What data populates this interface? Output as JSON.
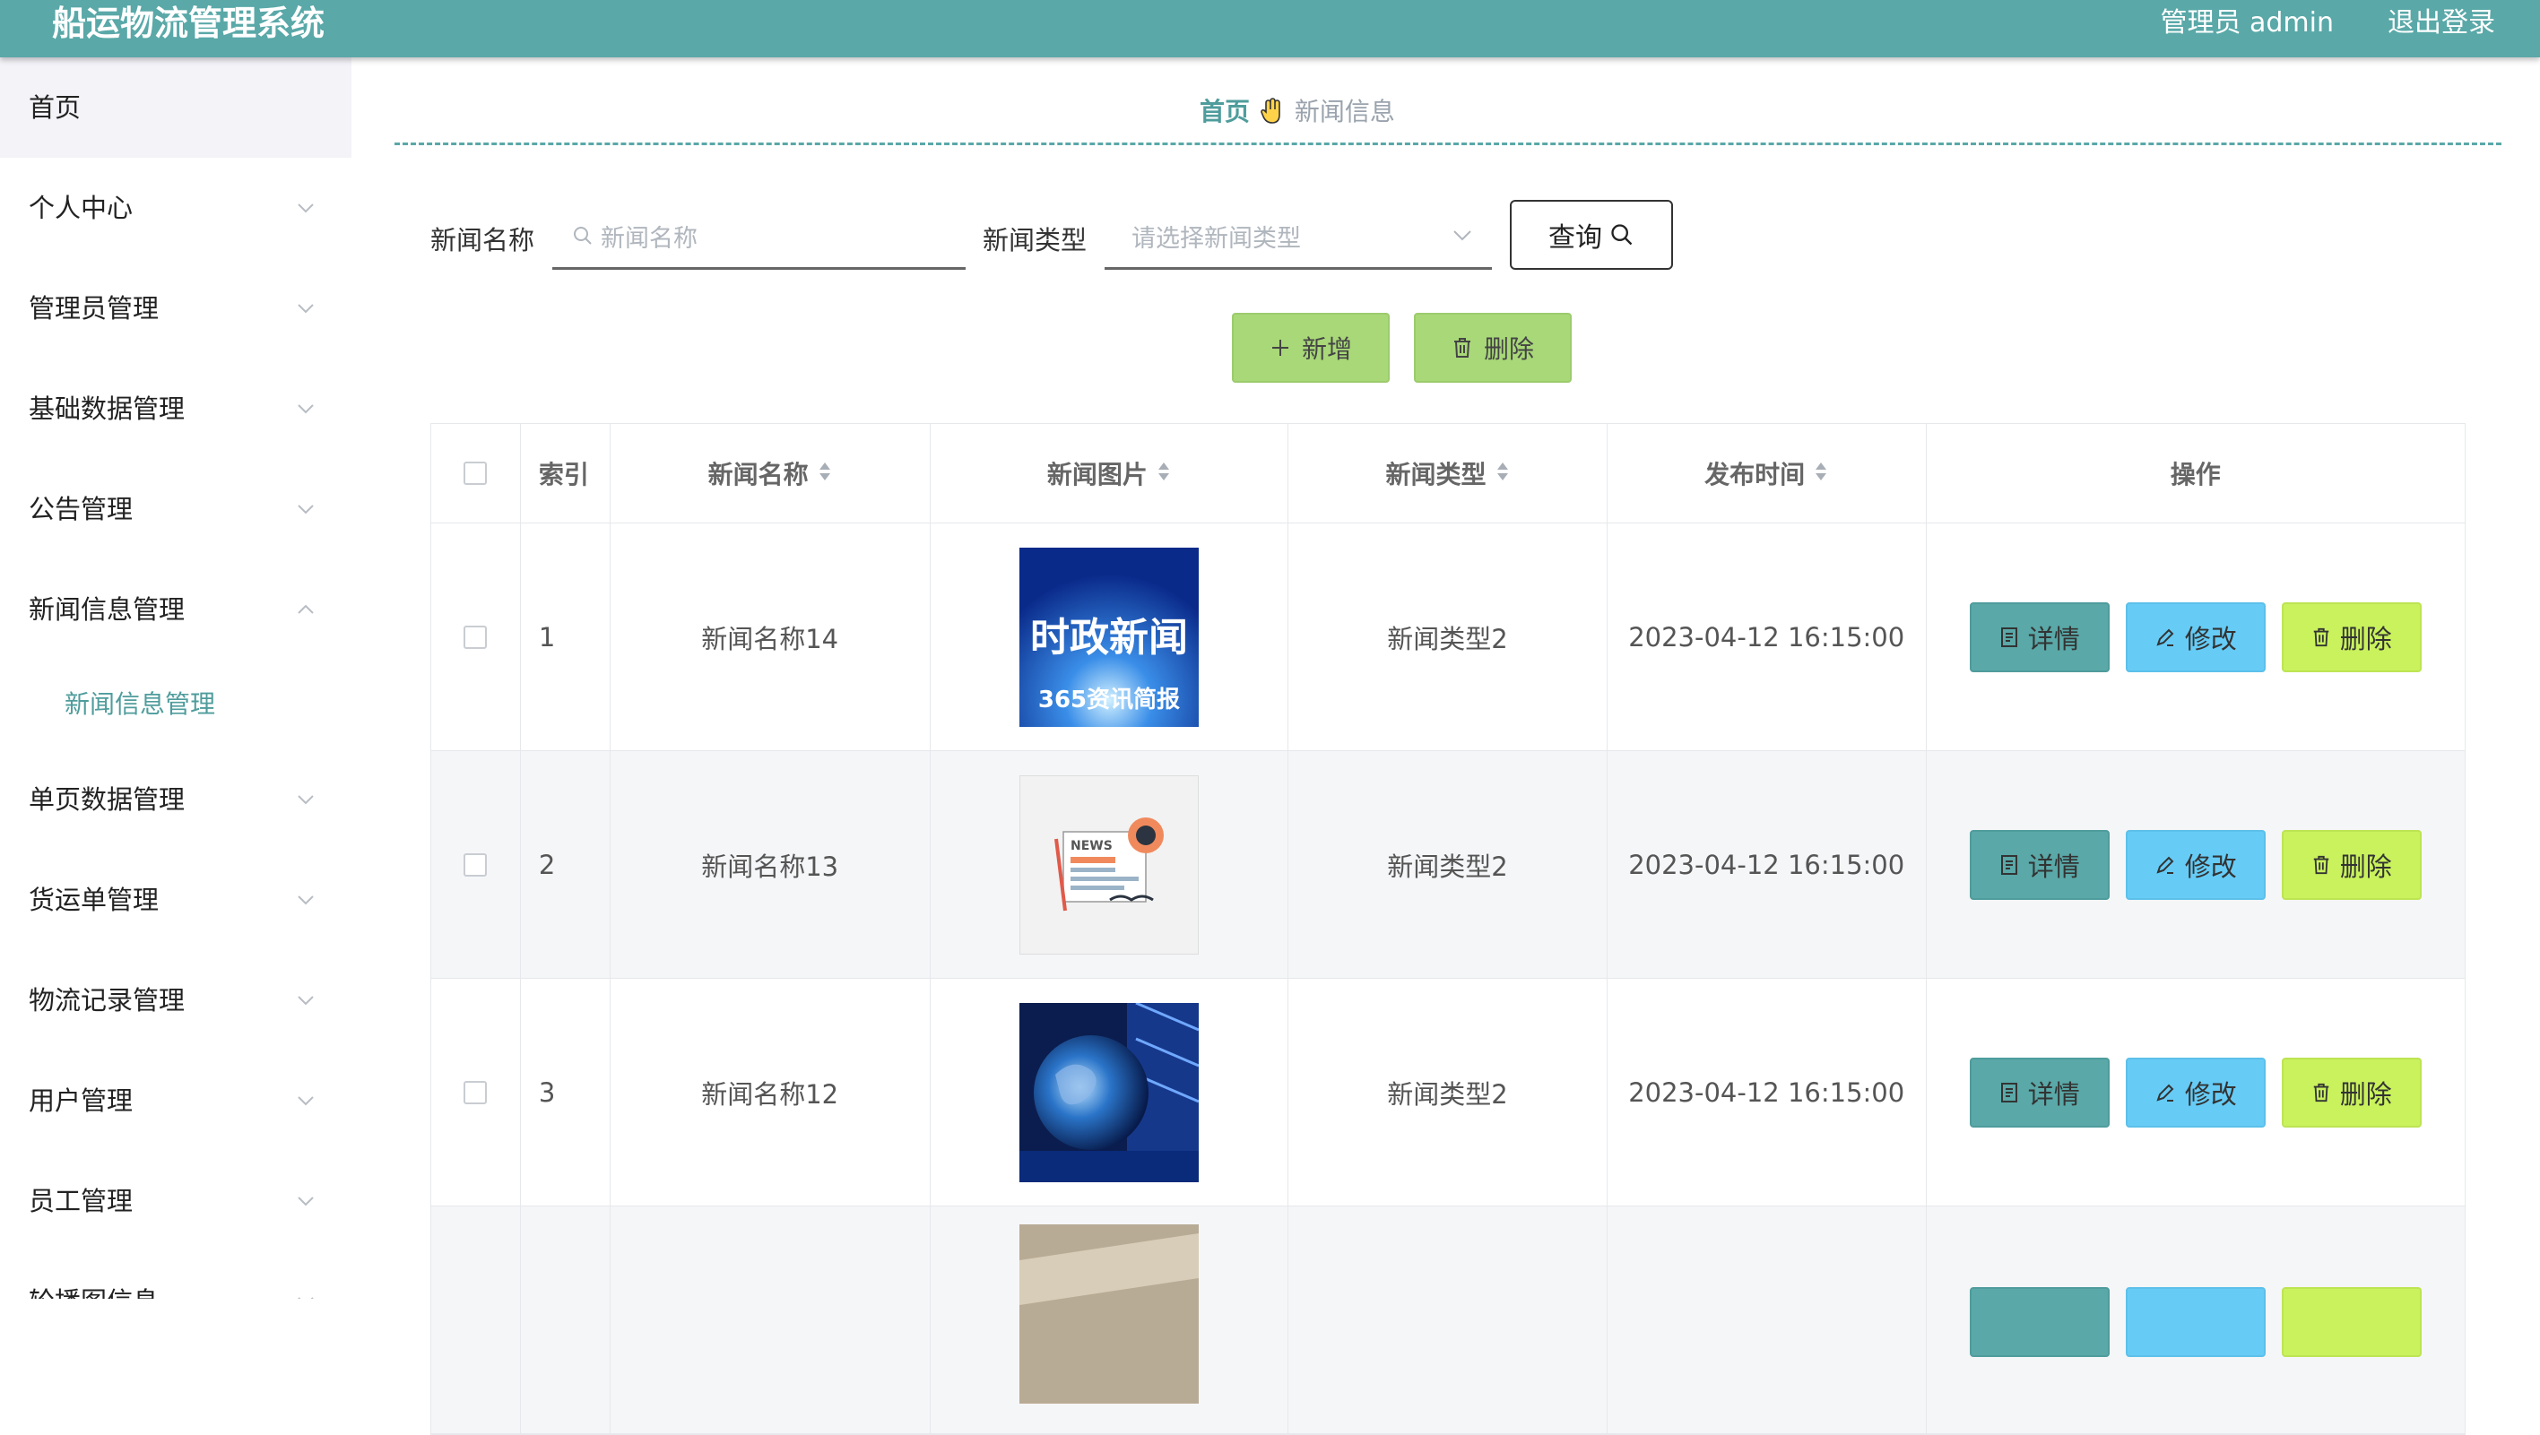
{
  "header": {
    "title": "船运物流管理系统",
    "user": "管理员 admin",
    "logout": "退出登录"
  },
  "sidebar": {
    "home": "首页",
    "items": [
      {
        "label": "个人中心"
      },
      {
        "label": "管理员管理"
      },
      {
        "label": "基础数据管理"
      },
      {
        "label": "公告管理"
      },
      {
        "label": "新闻信息管理",
        "sub": "新闻信息管理"
      },
      {
        "label": "单页数据管理"
      },
      {
        "label": "货运单管理"
      },
      {
        "label": "物流记录管理"
      },
      {
        "label": "用户管理"
      },
      {
        "label": "员工管理"
      },
      {
        "label": "轮播图信息"
      }
    ]
  },
  "breadcrumb": {
    "home": "首页",
    "current": "新闻信息"
  },
  "search": {
    "name_label": "新闻名称",
    "name_placeholder": "新闻名称",
    "type_label": "新闻类型",
    "type_placeholder": "请选择新闻类型",
    "query": "查询"
  },
  "actions": {
    "add": "新增",
    "delete": "删除"
  },
  "table": {
    "headers": [
      "索引",
      "新闻名称",
      "新闻图片",
      "新闻类型",
      "发布时间",
      "操作"
    ],
    "rows": [
      {
        "index": "1",
        "name": "新闻名称14",
        "type": "新闻类型2",
        "time": "2023-04-12 16:15:00",
        "img_text1": "时政新闻",
        "img_text2": "365资讯简报"
      },
      {
        "index": "2",
        "name": "新闻名称13",
        "type": "新闻类型2",
        "time": "2023-04-12 16:15:00",
        "img_text1": "NEWS"
      },
      {
        "index": "3",
        "name": "新闻名称12",
        "type": "新闻类型2",
        "time": "2023-04-12 16:15:00"
      }
    ],
    "row_actions": {
      "detail": "详情",
      "edit": "修改",
      "delete": "删除"
    }
  },
  "colors": {
    "primary": "#5aa8a8",
    "edit": "#66ccf6",
    "delete": "#c9f25d",
    "add": "#a8d878"
  }
}
